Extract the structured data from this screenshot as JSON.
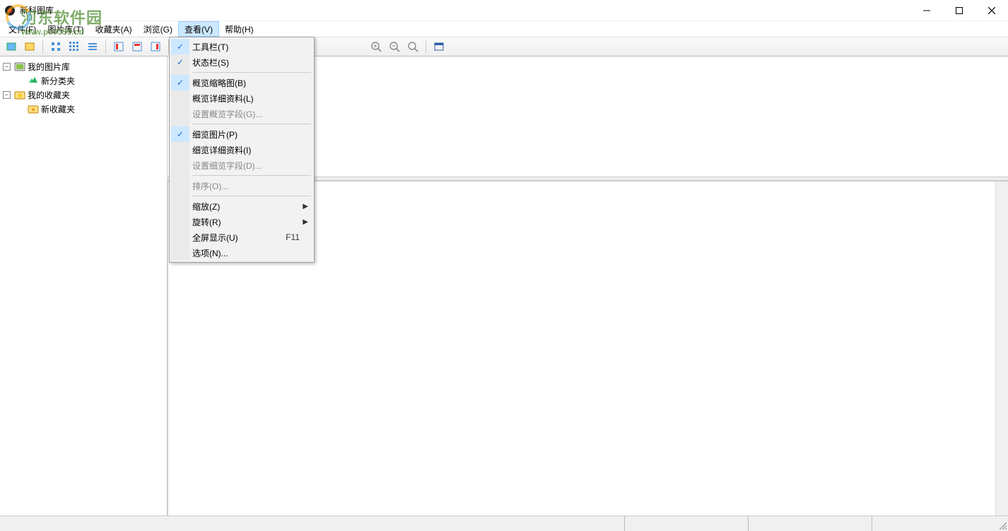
{
  "window": {
    "title": "新科图库"
  },
  "watermark": {
    "text": "河东软件园",
    "url": "www.pc0359.cn"
  },
  "menubar": {
    "file": "文件(F)",
    "library": "图片库(T)",
    "favorites": "收藏夹(A)",
    "browse": "浏览(G)",
    "view": "查看(V)",
    "help": "帮助(H)"
  },
  "tree": {
    "root1": "我的图片库",
    "child1": "新分类夹",
    "root2": "我的收藏夹",
    "child2": "新收藏夹"
  },
  "view_menu": {
    "toolbar": "工具栏(T)",
    "statusbar": "状态栏(S)",
    "thumb_overview": "概览缩略图(B)",
    "detail_overview": "概览详细资料(L)",
    "set_overview_fields": "设置概览字段(G)...",
    "detail_image": "细览图片(P)",
    "detail_info": "细览详细资料(I)",
    "set_detail_fields": "设置细览字段(D)...",
    "sort": "排序(O)...",
    "zoom": "缩放(Z)",
    "rotate": "旋转(R)",
    "fullscreen": "全屏显示(U)",
    "fullscreen_shortcut": "F11",
    "options": "选项(N)..."
  }
}
